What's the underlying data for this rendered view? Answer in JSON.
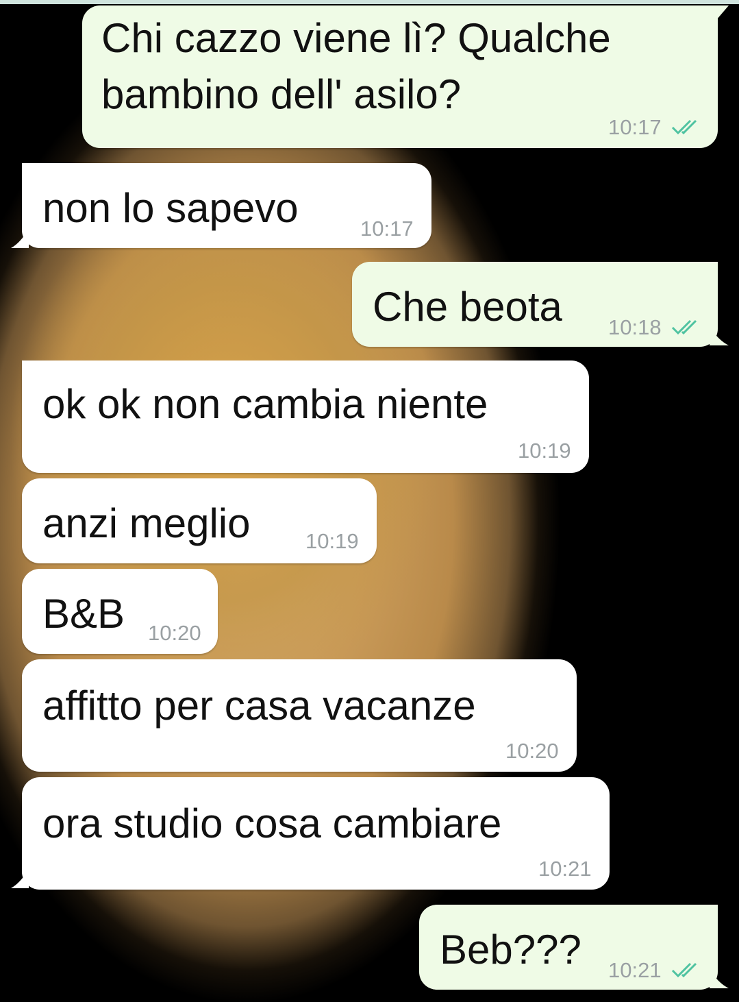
{
  "conversation": {
    "messages": [
      {
        "direction": "out",
        "lines": [
          "Chi cazzo viene lì? Qualche",
          "bambino dell' asilo?"
        ],
        "time": "10:17",
        "status": "read-double-tick-icon"
      },
      {
        "direction": "in",
        "lines": [
          "non lo sapevo"
        ],
        "time": "10:17"
      },
      {
        "direction": "out",
        "lines": [
          "Che beota"
        ],
        "time": "10:18",
        "status": "read-double-tick-icon"
      },
      {
        "direction": "in",
        "lines": [
          "ok ok non cambia niente"
        ],
        "time": "10:19"
      },
      {
        "direction": "in",
        "lines": [
          "anzi meglio"
        ],
        "time": "10:19"
      },
      {
        "direction": "in",
        "lines": [
          "B&B"
        ],
        "time": "10:20"
      },
      {
        "direction": "in",
        "lines": [
          "affitto per casa vacanze"
        ],
        "time": "10:20"
      },
      {
        "direction": "in",
        "lines": [
          "ora studio cosa cambiare"
        ],
        "time": "10:21"
      },
      {
        "direction": "out",
        "lines": [
          "Beb???"
        ],
        "time": "10:21",
        "status": "read-double-tick-icon"
      }
    ]
  },
  "colors": {
    "incoming_bubble": "#ffffff",
    "outgoing_bubble": "#effbe6",
    "read_ticks": "#4fc3a1",
    "timestamp": "#9aa0a3"
  }
}
